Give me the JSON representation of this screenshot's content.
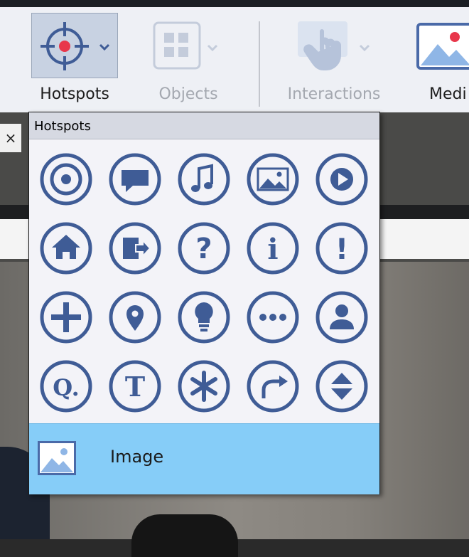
{
  "ribbon": {
    "hotspots_label": "Hotspots",
    "objects_label": "Objects",
    "interactions_label": "Interactions",
    "media_label": "Medi",
    "accent_color": "#4a6aa8",
    "active_dot_color": "#e8374b"
  },
  "tab": {
    "close_glyph": "×"
  },
  "dropdown": {
    "header": "Hotspots",
    "icons": [
      "target-icon",
      "speech-bubble-icon",
      "music-note-icon",
      "picture-icon",
      "play-icon",
      "home-icon",
      "exit-icon",
      "question-icon",
      "info-icon",
      "exclamation-icon",
      "plus-icon",
      "map-pin-icon",
      "lightbulb-icon",
      "more-icon",
      "person-icon",
      "letter-q-icon",
      "letter-t-icon",
      "asterisk-icon",
      "redo-arrow-icon",
      "up-down-icon"
    ],
    "glyphs": {
      "question": "?",
      "info": "i",
      "exclamation": "!",
      "letter_q": "Q.",
      "letter_t": "T"
    },
    "image_row": {
      "label": "Image"
    }
  }
}
